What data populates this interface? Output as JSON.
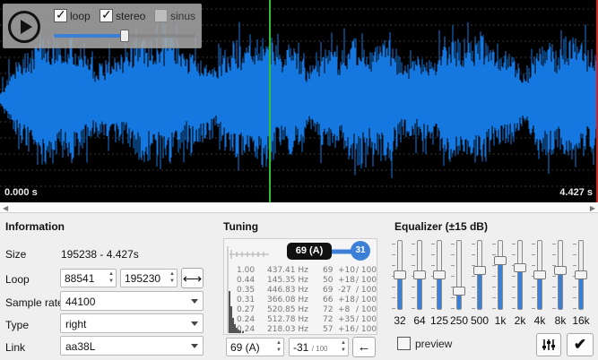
{
  "waveform": {
    "start_time": "0.000 s",
    "end_time": "4.427 s",
    "colors": {
      "wave": "#1478e0",
      "cursor": "#2fbf2f",
      "end_marker": "#d02020",
      "background": "#000000"
    }
  },
  "controls": {
    "play_icon": "play-icon",
    "loop": {
      "label": "loop",
      "checked": true
    },
    "stereo": {
      "label": "stereo",
      "checked": true
    },
    "sinus": {
      "label": "sinus",
      "checked": false
    },
    "volume_level": 0.5
  },
  "information": {
    "title": "Information",
    "size_label": "Size",
    "size_value": "195238 - 4.427s",
    "loop_label": "Loop",
    "loop_start": "88541",
    "loop_end": "195230",
    "loop_button_icon": "double-arrow-horizontal-icon",
    "sample_rate_label": "Sample rate",
    "sample_rate_value": "44100",
    "type_label": "Type",
    "type_value": "right",
    "link_label": "Link",
    "link_value": "aa38L"
  },
  "tuning": {
    "title": "Tuning",
    "bubble": "69 (A)",
    "knob_value": "31",
    "rows": [
      {
        "weight": "1.00",
        "freq": "437.41 Hz",
        "note": "69",
        "cents": "+10",
        "per": "/ 100"
      },
      {
        "weight": "0.44",
        "freq": "145.35 Hz",
        "note": "50",
        "cents": "+18",
        "per": "/ 100"
      },
      {
        "weight": "0.35",
        "freq": "446.83 Hz",
        "note": "69",
        "cents": "-27",
        "per": "/ 100"
      },
      {
        "weight": "0.31",
        "freq": "366.08 Hz",
        "note": "66",
        "cents": "+18",
        "per": "/ 100"
      },
      {
        "weight": "0.27",
        "freq": "520.85 Hz",
        "note": "72",
        "cents": "+8",
        "per": "/ 100"
      },
      {
        "weight": "0.24",
        "freq": "512.78 Hz",
        "note": "72",
        "cents": "+35",
        "per": "/ 100"
      },
      {
        "weight": "0.24",
        "freq": "218.03 Hz",
        "note": "57",
        "cents": "+16",
        "per": "/ 100"
      }
    ],
    "note_value": "69 (A)",
    "cents_value": "-31",
    "cents_suffix": "/ 100",
    "back_icon": "arrow-left-icon"
  },
  "equalizer": {
    "title": "Equalizer (±15 dB)",
    "bands": [
      {
        "label": "32",
        "level": 0.5
      },
      {
        "label": "64",
        "level": 0.5
      },
      {
        "label": "125",
        "level": 0.5
      },
      {
        "label": "250",
        "level": 0.27
      },
      {
        "label": "500",
        "level": 0.57
      },
      {
        "label": "1k",
        "level": 0.7
      },
      {
        "label": "2k",
        "level": 0.6
      },
      {
        "label": "4k",
        "level": 0.5
      },
      {
        "label": "8k",
        "level": 0.57
      },
      {
        "label": "16k",
        "level": 0.5
      }
    ],
    "preview_label": "preview",
    "preview_checked": false,
    "settings_icon": "equalizer-sliders-icon",
    "apply_icon": "checkmark-icon"
  }
}
